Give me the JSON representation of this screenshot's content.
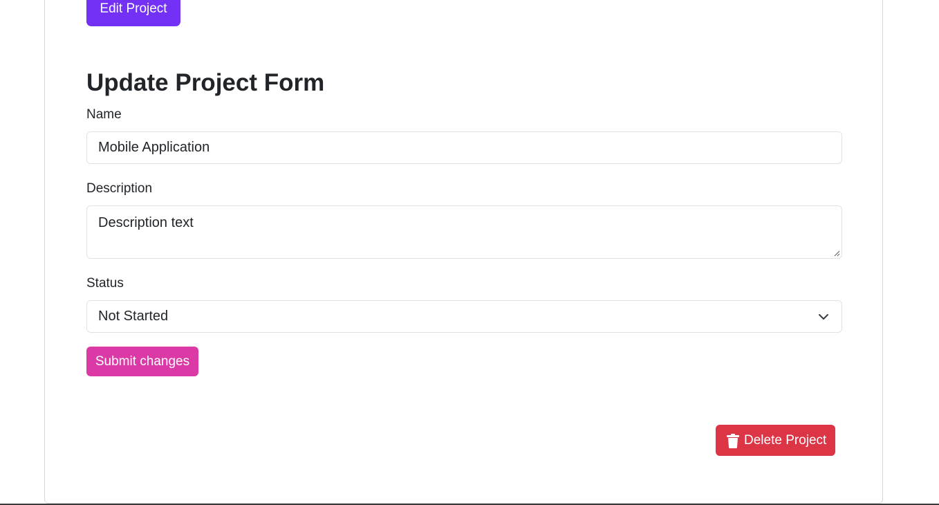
{
  "header": {
    "edit_button_label": "Edit Project"
  },
  "form": {
    "title": "Update Project Form",
    "name": {
      "label": "Name",
      "value": "Mobile Application"
    },
    "description": {
      "label": "Description",
      "value": "Description text"
    },
    "status": {
      "label": "Status",
      "selected": "Not Started"
    },
    "submit_label": "Submit changes"
  },
  "actions": {
    "delete_label": "Delete Project",
    "delete_icon": "trash-icon"
  },
  "colors": {
    "edit_button": "#7231f5",
    "submit_button": "#db3aa6",
    "delete_button": "#dc3545"
  }
}
